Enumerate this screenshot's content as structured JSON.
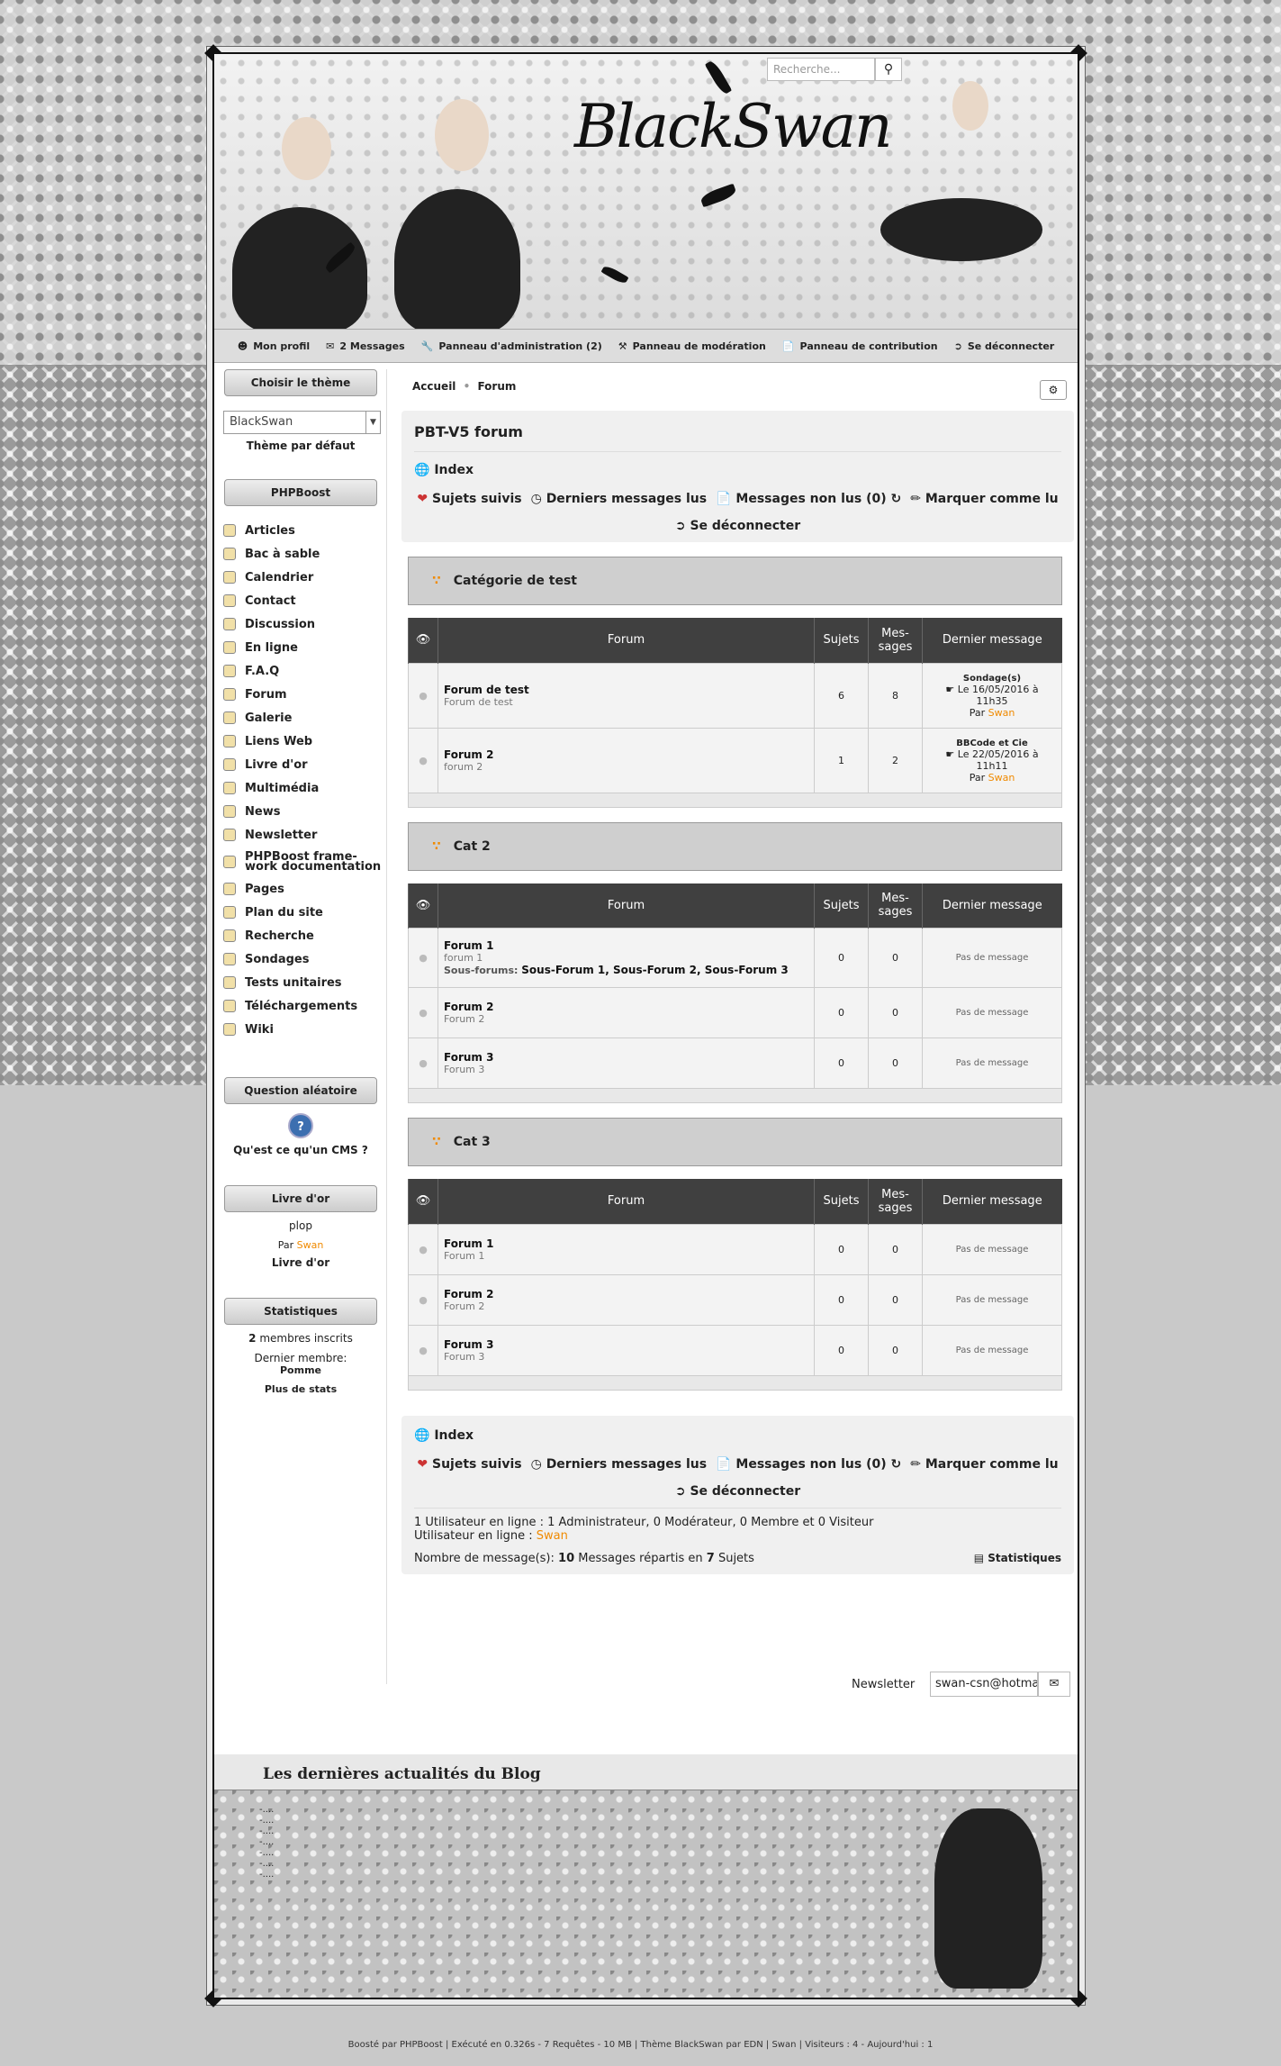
{
  "header": {
    "logo": "BlackSwan",
    "search_placeholder": "Recherche..."
  },
  "topmenu": [
    {
      "icon": "user-icon",
      "label": "Mon profil"
    },
    {
      "icon": "envelope-icon",
      "label": "2 Messages"
    },
    {
      "icon": "wrench-icon",
      "label": "Panneau d'administration (2)"
    },
    {
      "icon": "gavel-icon",
      "label": "Panneau de modération"
    },
    {
      "icon": "file-icon",
      "label": "Panneau de contribution"
    },
    {
      "icon": "signout-icon",
      "label": "Se déconnecter"
    }
  ],
  "theme": {
    "title": "Choisir le thème",
    "selected": "BlackSwan",
    "default_link": "Thème par défaut"
  },
  "phpboost": {
    "title": "PHPBoost",
    "items": [
      "Articles",
      "Bac à sable",
      "Calendrier",
      "Contact",
      "Discussion",
      "En ligne",
      "F.A.Q",
      "Forum",
      "Galerie",
      "Liens Web",
      "Livre d'or",
      "Multimédia",
      "News",
      "Newsletter",
      "PHPBoost frame-work documentation",
      "Pages",
      "Plan du site",
      "Recherche",
      "Sondages",
      "Tests unitaires",
      "Téléchargements",
      "Wiki"
    ]
  },
  "question": {
    "title": "Question aléatoire",
    "text": "Qu'est ce qu'un CMS ?"
  },
  "guestbook": {
    "title": "Livre d'or",
    "message": "plop",
    "by": "Par",
    "author": "Swan",
    "link": "Livre d'or"
  },
  "statistics": {
    "title": "Statistiques",
    "members_count": "2",
    "members_label": "membres inscrits",
    "last_member_label": "Dernier membre:",
    "last_member": "Pomme",
    "more": "Plus de stats"
  },
  "breadcrumb": {
    "home": "Accueil",
    "sep": "•",
    "current": "Forum"
  },
  "forum": {
    "title": "PBT-V5 forum",
    "index": "Index",
    "actions": {
      "followed": "Sujets suivis",
      "last_read": "Derniers messages lus",
      "unread": "Messages non lus (0)",
      "mark_read": "Marquer comme lu"
    },
    "logout": "Se déconnecter",
    "columns": {
      "forum": "Forum",
      "topics": "Sujets",
      "messages_1": "Mes-",
      "messages_2": "sages",
      "last": "Dernier message"
    },
    "categories": [
      {
        "name": "Catégorie de test",
        "forums": [
          {
            "name": "Forum de test",
            "desc": "Forum de test",
            "topics": "6",
            "messages": "8",
            "last_title": "Sondage(s)",
            "last_date": "Le 16/05/2016 à",
            "last_time": "11h35",
            "last_by": "Par",
            "last_author": "Swan"
          },
          {
            "name": "Forum 2",
            "desc": "forum 2",
            "topics": "1",
            "messages": "2",
            "last_title": "BBCode et Cie",
            "last_date": "Le 22/05/2016 à",
            "last_time": "11h11",
            "last_by": "Par",
            "last_author": "Swan"
          }
        ]
      },
      {
        "name": "Cat 2",
        "forums": [
          {
            "name": "Forum 1",
            "desc": "forum 1",
            "subs_label": "Sous-forums:",
            "subs": "Sous-Forum 1, Sous-Forum 2, Sous-Forum 3",
            "topics": "0",
            "messages": "0",
            "none": "Pas de message"
          },
          {
            "name": "Forum 2",
            "desc": "Forum 2",
            "topics": "0",
            "messages": "0",
            "none": "Pas de message"
          },
          {
            "name": "Forum 3",
            "desc": "Forum 3",
            "topics": "0",
            "messages": "0",
            "none": "Pas de message"
          }
        ]
      },
      {
        "name": "Cat 3",
        "forums": [
          {
            "name": "Forum 1",
            "desc": "Forum 1",
            "topics": "0",
            "messages": "0",
            "none": "Pas de message"
          },
          {
            "name": "Forum 2",
            "desc": "Forum 2",
            "topics": "0",
            "messages": "0",
            "none": "Pas de message"
          },
          {
            "name": "Forum 3",
            "desc": "Forum 3",
            "topics": "0",
            "messages": "0",
            "none": "Pas de message"
          }
        ]
      }
    ],
    "online_line": "1 Utilisateur en ligne : 1 Administrateur, 0 Modérateur, 0 Membre et 0 Visiteur",
    "online_users_label": "Utilisateur en ligne :",
    "online_user": "Swan",
    "msg_count_prefix": "Nombre de message(s):",
    "msg_count": "10",
    "msg_mid": "Messages répartis en",
    "topic_count": "7",
    "topic_suffix": "Sujets",
    "stats_link": "Statistiques"
  },
  "newsletter": {
    "label": "Newsletter",
    "value": "swan-csn@hotma"
  },
  "blog": {
    "title": "Les dernières actualités du Blog",
    "lines": [
      "-....",
      "-....",
      "-....",
      "-....",
      "-....",
      "-....",
      "-...."
    ]
  },
  "footer": {
    "text": "Boosté par PHPBoost | Exécuté en 0.326s - 7 Requêtes - 10 MB | Thème BlackSwan par EDN | Swan | Visiteurs : 4 - Aujourd'hui : 1"
  }
}
